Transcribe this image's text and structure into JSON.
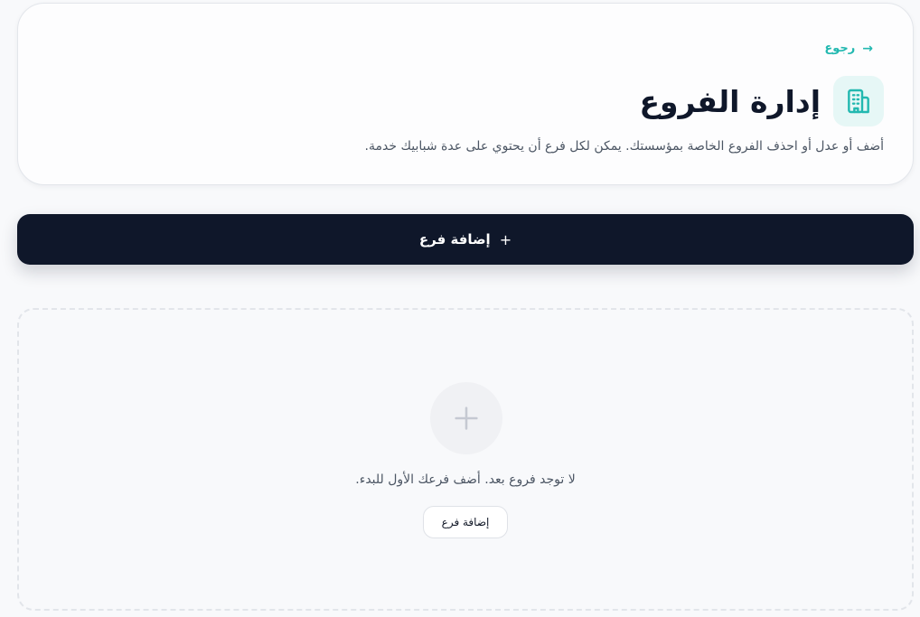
{
  "header": {
    "back_label": "رجوع",
    "title": "إدارة الفروع",
    "subtitle": "أضف أو عدل أو احذف الفروع الخاصة بمؤسستك. يمكن لكل فرع أن يحتوي على عدة شبابيك خدمة.",
    "title_icon": "building-icon",
    "back_icon": "arrow-right-icon"
  },
  "add_bar": {
    "label": "إضافة فرع",
    "icon": "plus-icon"
  },
  "empty_state": {
    "icon": "plus-icon",
    "message": "لا توجد فروع بعد. أضف فرعك الأول للبدء.",
    "button_label": "إضافة فرع"
  },
  "colors": {
    "accent": "#22b8b0",
    "dark": "#0f172a",
    "background": "#f8f9fb"
  }
}
